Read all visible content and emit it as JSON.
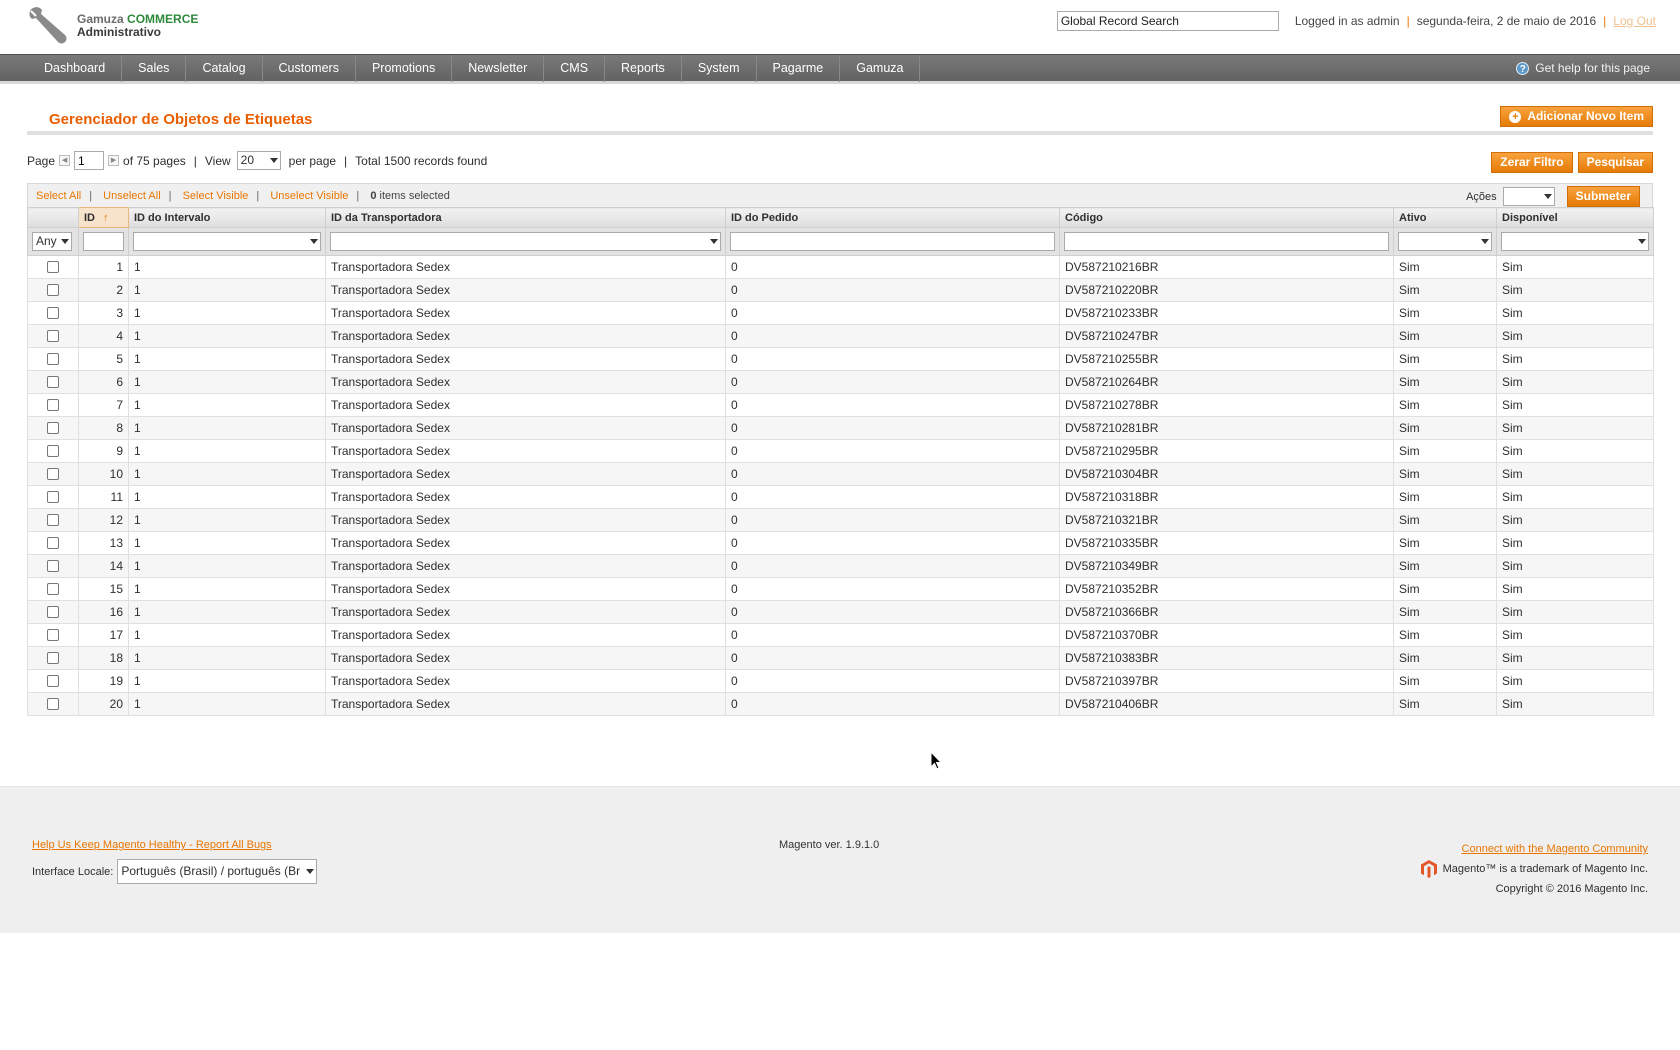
{
  "header": {
    "logo_line1_a": "Gamuza",
    "logo_line1_b": "COMMERCE",
    "logo_line2": "Administrativo",
    "search_value": "Global Record Search",
    "logged_in": "Logged in as admin",
    "date": "segunda-feira, 2 de maio de 2016",
    "logout": "Log Out"
  },
  "nav": {
    "items": [
      "Dashboard",
      "Sales",
      "Catalog",
      "Customers",
      "Promotions",
      "Newsletter",
      "CMS",
      "Reports",
      "System",
      "Pagarme",
      "Gamuza"
    ],
    "help": "Get help for this page"
  },
  "page": {
    "title": "Gerenciador de Objetos de Etiquetas",
    "add_button": "Adicionar Novo Item"
  },
  "pager": {
    "page_label": "Page",
    "page_value": "1",
    "of_pages": "of 75 pages",
    "view_label": "View",
    "view_value": "20",
    "per_page": "per page",
    "total": "Total 1500 records found",
    "reset_filter": "Zerar Filtro",
    "search": "Pesquisar"
  },
  "massaction": {
    "select_all": "Select All",
    "unselect_all": "Unselect All",
    "select_visible": "Select Visible",
    "unselect_visible": "Unselect Visible",
    "count": "0",
    "items_selected": "items selected",
    "actions_label": "Ações",
    "submit": "Submeter"
  },
  "grid": {
    "columns": [
      "ID",
      "ID do Intervalo",
      "ID da Transportadora",
      "ID do Pedido",
      "Código",
      "Ativo",
      "Disponível"
    ],
    "filter_any": "Any",
    "rows": [
      {
        "id": "1",
        "intervalo": "1",
        "transportadora": "Transportadora Sedex",
        "pedido": "0",
        "codigo": "DV587210216BR",
        "ativo": "Sim",
        "disponivel": "Sim"
      },
      {
        "id": "2",
        "intervalo": "1",
        "transportadora": "Transportadora Sedex",
        "pedido": "0",
        "codigo": "DV587210220BR",
        "ativo": "Sim",
        "disponivel": "Sim"
      },
      {
        "id": "3",
        "intervalo": "1",
        "transportadora": "Transportadora Sedex",
        "pedido": "0",
        "codigo": "DV587210233BR",
        "ativo": "Sim",
        "disponivel": "Sim"
      },
      {
        "id": "4",
        "intervalo": "1",
        "transportadora": "Transportadora Sedex",
        "pedido": "0",
        "codigo": "DV587210247BR",
        "ativo": "Sim",
        "disponivel": "Sim"
      },
      {
        "id": "5",
        "intervalo": "1",
        "transportadora": "Transportadora Sedex",
        "pedido": "0",
        "codigo": "DV587210255BR",
        "ativo": "Sim",
        "disponivel": "Sim"
      },
      {
        "id": "6",
        "intervalo": "1",
        "transportadora": "Transportadora Sedex",
        "pedido": "0",
        "codigo": "DV587210264BR",
        "ativo": "Sim",
        "disponivel": "Sim"
      },
      {
        "id": "7",
        "intervalo": "1",
        "transportadora": "Transportadora Sedex",
        "pedido": "0",
        "codigo": "DV587210278BR",
        "ativo": "Sim",
        "disponivel": "Sim"
      },
      {
        "id": "8",
        "intervalo": "1",
        "transportadora": "Transportadora Sedex",
        "pedido": "0",
        "codigo": "DV587210281BR",
        "ativo": "Sim",
        "disponivel": "Sim"
      },
      {
        "id": "9",
        "intervalo": "1",
        "transportadora": "Transportadora Sedex",
        "pedido": "0",
        "codigo": "DV587210295BR",
        "ativo": "Sim",
        "disponivel": "Sim"
      },
      {
        "id": "10",
        "intervalo": "1",
        "transportadora": "Transportadora Sedex",
        "pedido": "0",
        "codigo": "DV587210304BR",
        "ativo": "Sim",
        "disponivel": "Sim"
      },
      {
        "id": "11",
        "intervalo": "1",
        "transportadora": "Transportadora Sedex",
        "pedido": "0",
        "codigo": "DV587210318BR",
        "ativo": "Sim",
        "disponivel": "Sim"
      },
      {
        "id": "12",
        "intervalo": "1",
        "transportadora": "Transportadora Sedex",
        "pedido": "0",
        "codigo": "DV587210321BR",
        "ativo": "Sim",
        "disponivel": "Sim"
      },
      {
        "id": "13",
        "intervalo": "1",
        "transportadora": "Transportadora Sedex",
        "pedido": "0",
        "codigo": "DV587210335BR",
        "ativo": "Sim",
        "disponivel": "Sim"
      },
      {
        "id": "14",
        "intervalo": "1",
        "transportadora": "Transportadora Sedex",
        "pedido": "0",
        "codigo": "DV587210349BR",
        "ativo": "Sim",
        "disponivel": "Sim"
      },
      {
        "id": "15",
        "intervalo": "1",
        "transportadora": "Transportadora Sedex",
        "pedido": "0",
        "codigo": "DV587210352BR",
        "ativo": "Sim",
        "disponivel": "Sim"
      },
      {
        "id": "16",
        "intervalo": "1",
        "transportadora": "Transportadora Sedex",
        "pedido": "0",
        "codigo": "DV587210366BR",
        "ativo": "Sim",
        "disponivel": "Sim"
      },
      {
        "id": "17",
        "intervalo": "1",
        "transportadora": "Transportadora Sedex",
        "pedido": "0",
        "codigo": "DV587210370BR",
        "ativo": "Sim",
        "disponivel": "Sim"
      },
      {
        "id": "18",
        "intervalo": "1",
        "transportadora": "Transportadora Sedex",
        "pedido": "0",
        "codigo": "DV587210383BR",
        "ativo": "Sim",
        "disponivel": "Sim"
      },
      {
        "id": "19",
        "intervalo": "1",
        "transportadora": "Transportadora Sedex",
        "pedido": "0",
        "codigo": "DV587210397BR",
        "ativo": "Sim",
        "disponivel": "Sim"
      },
      {
        "id": "20",
        "intervalo": "1",
        "transportadora": "Transportadora Sedex",
        "pedido": "0",
        "codigo": "DV587210406BR",
        "ativo": "Sim",
        "disponivel": "Sim"
      }
    ]
  },
  "footer": {
    "report_bugs": "Help Us Keep Magento Healthy - Report All Bugs",
    "locale_label": "Interface Locale:",
    "locale_value": "Português (Brasil) / português (Br",
    "version": "Magento ver. 1.9.1.0",
    "community": "Connect with the Magento Community",
    "trademark": "Magento™ is a trademark of Magento Inc.",
    "copyright": "Copyright © 2016 Magento Inc."
  },
  "colors": {
    "accent": "#ea7601",
    "title": "#eb5e00",
    "nav": "#6f6f6f"
  }
}
